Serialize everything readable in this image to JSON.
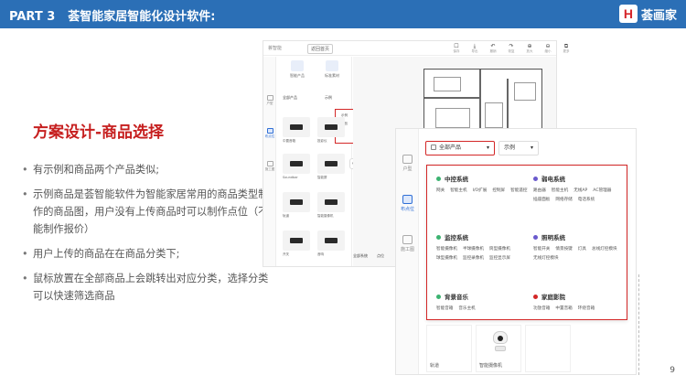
{
  "header": {
    "part": "PART 3",
    "title": "荟智能家居智能化设计软件:",
    "brand_mark": "H",
    "brand_name": "荟画家",
    "bg_color": "#2b6fb6"
  },
  "section_title": "方案设计-商品选择",
  "bullets": [
    "有示例和商品两个产品类似;",
    "示例商品是荟智能软件为智能家居常用的商品类型制作的商品图，用户没有上传商品时可以制作点位（不能制作报价）",
    "用户上传的商品在在商品分类下;",
    "鼠标放置在全部商品上会跳转出对应分类，选择分类可以快速筛选商品"
  ],
  "page_number": "9",
  "screenshot": {
    "app_logo": "荟智能",
    "back_button": "返回首页",
    "toolbar": [
      {
        "glyph": "☐",
        "label": "保存"
      },
      {
        "glyph": "⤓",
        "label": "导出"
      },
      {
        "glyph": "↶",
        "label": "撤销"
      },
      {
        "glyph": "↷",
        "label": "恢复"
      },
      {
        "glyph": "⊕",
        "label": "放大"
      },
      {
        "glyph": "⊖",
        "label": "缩小"
      },
      {
        "glyph": "⧉",
        "label": "更多"
      }
    ],
    "rail": [
      {
        "label": "户型",
        "active": false
      },
      {
        "label": "布点位",
        "active": true
      },
      {
        "label": "施工图",
        "active": false
      }
    ],
    "panel_tabs": [
      "智能产品",
      "标准素材"
    ],
    "filter_all": "全部产品",
    "filter_example": "示例",
    "example_options": [
      "示例",
      "商品"
    ],
    "grid_items": [
      {
        "caption": "中置音箱"
      },
      {
        "caption": "投影仪"
      },
      {
        "caption": "Soundbar"
      },
      {
        "caption": "智能屏"
      },
      {
        "caption": "轨道"
      },
      {
        "caption": "智能摄像机"
      },
      {
        "caption": "开关"
      },
      {
        "caption": "音响"
      }
    ],
    "bottom_tabs": [
      "全部系统",
      "点位"
    ]
  },
  "zoom": {
    "rail": [
      {
        "label": "户型",
        "active": false
      },
      {
        "label": "布点位",
        "active": true
      },
      {
        "label": "施工图",
        "active": false
      }
    ],
    "select_all": "全部产品",
    "select_example": "示例",
    "categories": [
      {
        "name": "中控系统",
        "dot_color": "#3cb371",
        "items": [
          "网关",
          "智能主机",
          "I/O扩展",
          "控制屏",
          "智能遥控"
        ]
      },
      {
        "name": "弱电系统",
        "dot_color": "#6a5acd",
        "items": [
          "路由器",
          "智能主机",
          "无线AP",
          "AC管理器",
          "插座面板",
          "网络存储",
          "电话系统"
        ]
      },
      {
        "name": "监控系统",
        "dot_color": "#3cb371",
        "items": [
          "智能摄像机",
          "半球摄像机",
          "筒型摄像机",
          "球型摄像机",
          "监控录像机",
          "监控显示屏"
        ]
      },
      {
        "name": "照明系统",
        "dot_color": "#6a5acd",
        "items": [
          "智能开关",
          "情景按键",
          "灯具",
          "总线灯控模块",
          "无线灯控模块"
        ]
      },
      {
        "name": "背景音乐",
        "dot_color": "#3cb371",
        "items": [
          "智能音箱",
          "音乐主机"
        ]
      },
      {
        "name": "家庭影院",
        "dot_color": "#d32727",
        "items": [
          "功放音箱",
          "中置音箱",
          "环绕音箱"
        ]
      }
    ],
    "cards": [
      {
        "caption": "轨道"
      },
      {
        "caption": "智能摄像机"
      }
    ],
    "highlight_color": "#d32727"
  }
}
